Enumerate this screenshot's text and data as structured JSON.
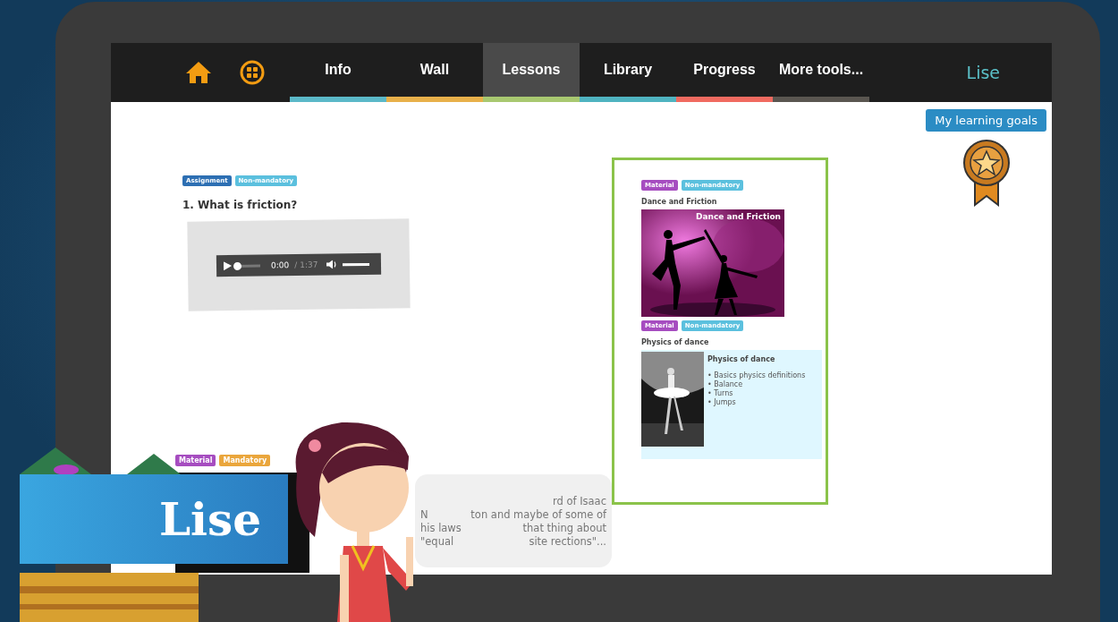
{
  "nav": {
    "tabs": [
      {
        "label": "Info",
        "selected": false,
        "color": "#5bb8c8"
      },
      {
        "label": "Wall",
        "selected": false,
        "color": "#e8b04a"
      },
      {
        "label": "Lessons",
        "selected": true,
        "color": "#a8c870"
      },
      {
        "label": "Library",
        "selected": false,
        "color": "#4fb3c0"
      },
      {
        "label": "Progress",
        "selected": false,
        "color": "#f06a60"
      },
      {
        "label": "More tools...",
        "selected": false,
        "color": "#5a5650"
      }
    ],
    "user": "Lise"
  },
  "goals_button": "My learning goals",
  "assignment": {
    "tags": [
      {
        "label": "Assignment",
        "color": "#2d6fb3"
      },
      {
        "label": "Non-mandatory",
        "color": "#5bc0de"
      }
    ],
    "question": "1. What is friction?",
    "audio": {
      "position": "0:00",
      "duration": "/ 1:37",
      "level": 0,
      "volume": {
        "level": 1
      }
    }
  },
  "materials": [
    {
      "tags": [
        {
          "label": "Material",
          "color": "#a64dc0"
        },
        {
          "label": "Non-mandatory",
          "color": "#5bc0de"
        }
      ],
      "title": "Dance and Friction",
      "caption": "Dance and Friction"
    },
    {
      "kind": "slide",
      "tags": [
        {
          "label": "Material",
          "color": "#a64dc0"
        },
        {
          "label": "Non-mandatory",
          "color": "#5bc0de"
        }
      ],
      "title": "Physics of dance",
      "panel_title": "Physics of dance",
      "bullets": [
        "• Basics physics definitions",
        "• Balance",
        "• Turns",
        "• Jumps"
      ]
    }
  ],
  "bottom_material": {
    "tags": [
      {
        "label": "Material",
        "color": "#a64dc0"
      },
      {
        "label": "Mandatory",
        "color": "#eaa63c"
      }
    ]
  },
  "speech_bubble": {
    "lines": [
      [
        "rd of Isaac"
      ],
      [
        "N",
        "ton and maybe of some of"
      ],
      [
        "his laws",
        "that thing about"
      ],
      [
        "\"equal",
        "site rections\"..."
      ]
    ]
  },
  "name_banner": "Lise"
}
